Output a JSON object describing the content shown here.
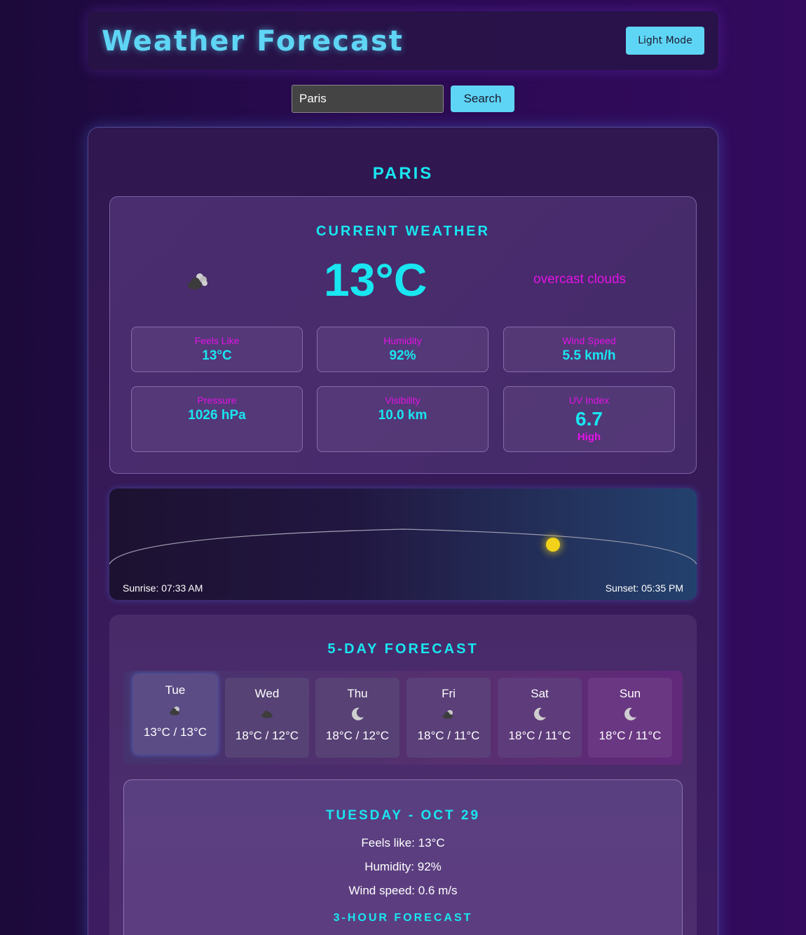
{
  "header": {
    "title": "Weather Forecast",
    "mode_button": "Light Mode"
  },
  "search": {
    "value": "Paris",
    "button": "Search"
  },
  "city": "PARIS",
  "current": {
    "heading": "CURRENT WEATHER",
    "icon": "clouds-icon",
    "temperature": "13°C",
    "description": "overcast clouds",
    "stats": [
      {
        "label": "Feels Like",
        "value": "13°C"
      },
      {
        "label": "Humidity",
        "value": "92%"
      },
      {
        "label": "Wind Speed",
        "value": "5.5 km/h"
      },
      {
        "label": "Pressure",
        "value": "1026 hPa"
      },
      {
        "label": "Visibility",
        "value": "10.0 km"
      },
      {
        "label": "UV Index",
        "value": "6.7",
        "sub": "High"
      }
    ]
  },
  "sun": {
    "sunrise": "Sunrise: 07:33 AM",
    "sunset": "Sunset: 05:35 PM",
    "sun_color": "#f2d21a"
  },
  "forecast": {
    "heading": "5-DAY FORECAST",
    "days": [
      {
        "day": "Tue",
        "icon": "partly-cloudy-icon",
        "temps": "13°C / 13°C",
        "selected": true
      },
      {
        "day": "Wed",
        "icon": "cloud-icon",
        "temps": "18°C / 12°C"
      },
      {
        "day": "Thu",
        "icon": "moon-icon",
        "temps": "18°C / 12°C"
      },
      {
        "day": "Fri",
        "icon": "partly-cloudy-icon",
        "temps": "18°C / 11°C"
      },
      {
        "day": "Sat",
        "icon": "moon-icon",
        "temps": "18°C / 11°C"
      },
      {
        "day": "Sun",
        "icon": "moon-icon",
        "temps": "18°C / 11°C"
      }
    ]
  },
  "detail": {
    "title": "TUESDAY - OCT 29",
    "feels_like": "Feels like: 13°C",
    "humidity": "Humidity: 92%",
    "wind": "Wind speed: 0.6 m/s",
    "hourly_heading": "3-HOUR FORECAST"
  },
  "colors": {
    "accent_cyan": "#19e6f0",
    "accent_magenta": "#e313e5",
    "button": "#5fd5f5"
  }
}
